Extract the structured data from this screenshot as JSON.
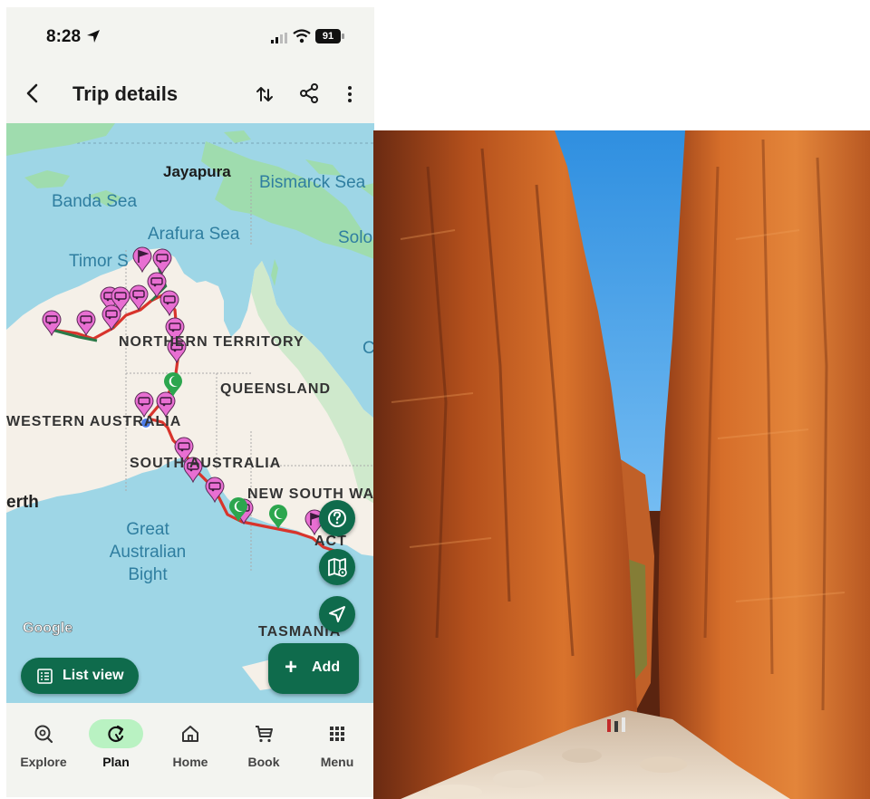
{
  "status_bar": {
    "time": "8:28",
    "battery": "91"
  },
  "header": {
    "title": "Trip details"
  },
  "map": {
    "labels": {
      "jayapura": "Jayapura",
      "bismarck_sea": "Bismarck Sea",
      "banda_sea": "Banda Sea",
      "arafura_sea": "Arafura Sea",
      "solo": "Solo",
      "timor_sea": "Timor S",
      "northern_territory": "NORTHERN TERRITORY",
      "queensland": "QUEENSLAND",
      "western_australia": "WESTERN AUSTRALIA",
      "south_australia": "SOUTH AUSTRALIA",
      "new_south_wales": "NEW SOUTH WALES",
      "act": "ACT",
      "perth": "erth",
      "great_australian_bight": "Great Australian Bight",
      "tasmania": "TASMANIA",
      "c": "C"
    },
    "google_logo": "Google",
    "list_view_label": "List view",
    "add_label": "Add",
    "colors": {
      "route": "#d8342c",
      "campsite_pin": "#e86fd2",
      "overnight_pin": "#2ca64e",
      "fab": "#0f6b4c"
    }
  },
  "bottom_nav": {
    "items": [
      {
        "label": "Explore",
        "icon": "explore-icon"
      },
      {
        "label": "Plan",
        "icon": "plan-icon",
        "selected": true
      },
      {
        "label": "Home",
        "icon": "home-icon"
      },
      {
        "label": "Book",
        "icon": "cart-icon"
      },
      {
        "label": "Menu",
        "icon": "grid-icon"
      }
    ]
  }
}
